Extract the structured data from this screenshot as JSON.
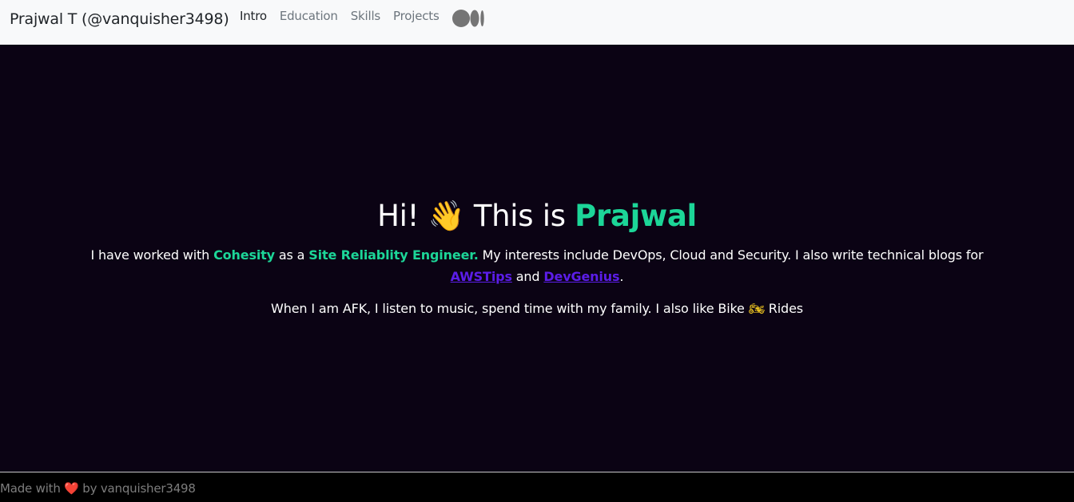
{
  "navbar": {
    "brand": "Prajwal T (@vanquisher3498)",
    "links": [
      {
        "label": "Intro",
        "active": true
      },
      {
        "label": "Education",
        "active": false
      },
      {
        "label": "Skills",
        "active": false
      },
      {
        "label": "Projects",
        "active": false
      }
    ],
    "social_icon": "medium-icon"
  },
  "hero": {
    "title_greeting": "Hi!",
    "title_wave": "👋",
    "title_middle": "This is",
    "title_name": "Prajwal",
    "line1_part1": "I have worked with ",
    "line1_company": "Cohesity",
    "line1_part2": " as a ",
    "line1_role": "Site Reliablity Engineer.",
    "line1_part3": " My interests include DevOps, Cloud and Security. I also write technical blogs for",
    "link_awstips": "AWSTips",
    "line1_and": " and ",
    "link_devgenius": "DevGenius",
    "line1_end": ".",
    "line2_part1": "When I am AFK, I listen to music, spend time with my family. I also like Bike ",
    "line2_bike": "🏍",
    "line2_part2": " Rides"
  },
  "footer": {
    "prefix": "Made with ",
    "heart": "❤️",
    "suffix": " by vanquisher3498"
  },
  "colors": {
    "nav_bg": "#f8f9fa",
    "hero_bg": "#0b0314",
    "accent": "#1cd698",
    "link": "#5b1de8",
    "footer_bg": "#000000"
  }
}
